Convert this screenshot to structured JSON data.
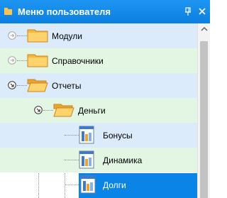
{
  "panel": {
    "title": "Меню пользователя",
    "icons": {
      "title": "folder-icon",
      "pin": "pin-icon",
      "close": "close-icon"
    }
  },
  "tree": {
    "items": [
      {
        "label": "Модули",
        "state": "collapsed",
        "icon": "folder-icon"
      },
      {
        "label": "Справочники",
        "state": "collapsed",
        "icon": "folder-icon"
      },
      {
        "label": "Отчеты",
        "state": "expanded",
        "icon": "open-folder-icon"
      },
      {
        "label": "Деньги",
        "state": "expanded",
        "icon": "open-folder-icon"
      },
      {
        "label": "Бонусы",
        "icon": "report-icon"
      },
      {
        "label": "Динамика",
        "icon": "report-icon"
      },
      {
        "label": "Долги",
        "icon": "report-icon",
        "selected": true
      }
    ]
  },
  "colors": {
    "accent": "#0a84e6",
    "row_blue": "#dcebfb",
    "row_green": "#e3f5e3",
    "selected": "#0a84e6"
  }
}
